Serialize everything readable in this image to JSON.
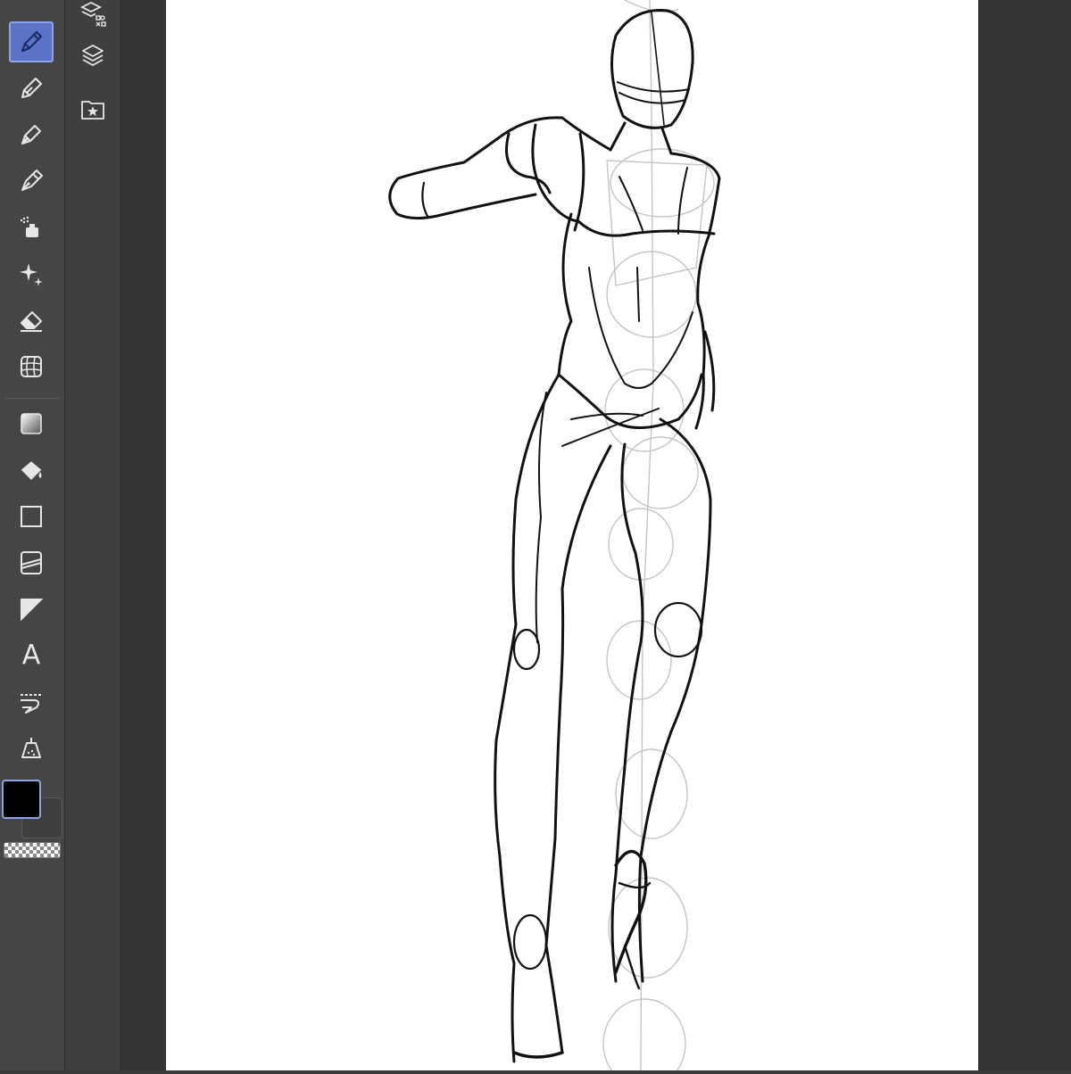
{
  "toolbar": {
    "tools": [
      {
        "name": "pen",
        "icon": "pen-icon",
        "active": true
      },
      {
        "name": "pencil",
        "icon": "pencil-icon"
      },
      {
        "name": "brush",
        "icon": "brush-icon"
      },
      {
        "name": "decoration",
        "icon": "nib-icon"
      },
      {
        "name": "airbrush",
        "icon": "airbrush-icon"
      },
      {
        "name": "sparkle",
        "icon": "sparkle-icon"
      },
      {
        "name": "eraser",
        "icon": "eraser-icon"
      },
      {
        "name": "grid",
        "icon": "grid-icon"
      },
      {
        "name": "gradient",
        "icon": "gradient-icon"
      },
      {
        "name": "fill",
        "icon": "bucket-icon"
      },
      {
        "name": "figure",
        "icon": "rectangle-icon"
      },
      {
        "name": "ruler",
        "icon": "ruler-icon"
      },
      {
        "name": "frame",
        "icon": "frame-icon"
      },
      {
        "name": "text",
        "icon": "text-icon",
        "glyph": "A"
      },
      {
        "name": "balloon",
        "icon": "balloon-icon"
      },
      {
        "name": "correct-line",
        "icon": "correct-line-icon"
      }
    ],
    "colors": {
      "foreground": "#000000",
      "background": "#3f3f3f",
      "accent": "#5c73c7"
    }
  },
  "panels": [
    {
      "icon": "material-layers-icon"
    },
    {
      "icon": "layers-icon"
    },
    {
      "icon": "favorites-folder-icon"
    }
  ]
}
